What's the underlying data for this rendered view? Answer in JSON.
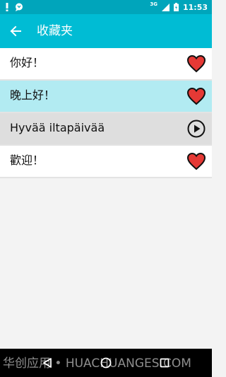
{
  "status": {
    "time": "11:53",
    "network": "3G"
  },
  "app_bar": {
    "title": "收藏夹"
  },
  "items": [
    {
      "text": "你好！",
      "action": "heart-icon"
    },
    {
      "text": "晚上好！",
      "action": "heart-icon"
    },
    {
      "text": "Hyvää iltapäivää",
      "action": "play-icon"
    },
    {
      "text": "歡迎！",
      "action": "heart-icon"
    }
  ],
  "colors": {
    "accent": "#00bcd4",
    "status_bar": "#00a5bb",
    "highlight": "#b2ebf2",
    "heart": "#e53935"
  },
  "watermark": "华创应用 • HUACHUANGES.COM"
}
